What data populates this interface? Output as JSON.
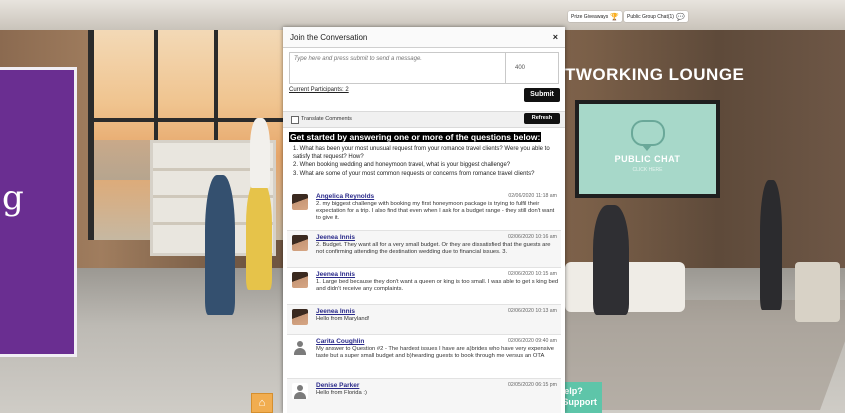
{
  "header_buttons": {
    "prize": "Prize Giveaways",
    "public_chat": "Public Group Chat(1)"
  },
  "lounge": {
    "title": "TWORKING LOUNGE",
    "screen_title": "PUBLIC CHAT",
    "screen_sub": "CLICK HERE"
  },
  "side_panel": {
    "glyph": "g"
  },
  "support": {
    "line1": "Need Help?",
    "line2": "Technical Support"
  },
  "modal": {
    "title": "Join the Conversation",
    "close": "×",
    "placeholder": "Type here and press submit to send a message.",
    "char_count": "400",
    "participants": "Current Participants: 2",
    "submit": "Submit",
    "translate": "Translate Comments",
    "refresh": "Refresh",
    "questions_title": "Get started by answering one or more of the questions below:",
    "questions": [
      "1. What has been your most unusual request from your romance travel clients? Were you able to satisfy that request? How?",
      "2. When booking wedding and honeymoon travel, what is your biggest challenge?",
      "3. What are some of your most common requests or concerns from romance travel clients?"
    ],
    "messages": [
      {
        "name": "Angelica Reynolds",
        "time": "02/06/2020 11:18 am",
        "text": "2.  my biggest challenge with booking my first honeymoon package is trying to fulfil their expectation for a trip.  I also find that even when I ask for a budget range - they still don't want to give it.",
        "avatar": "photo"
      },
      {
        "name": "Jeenea Innis",
        "time": "02/06/2020 10:16 am",
        "text": "2. Budget. They want all for a very small budget. Or they are dissatisfied that the guests are not confirming attending the destination wedding due to financial issues. 3.",
        "avatar": "photo"
      },
      {
        "name": "Jeenea Innis",
        "time": "02/06/2020 10:15 am",
        "text": "1. Large bed because they don't want a queen or king is too small. I was able to get s king bed and didn't receive any complaints.",
        "avatar": "photo"
      },
      {
        "name": "Jeenea Innis",
        "time": "02/06/2020 10:13 am",
        "text": "Hello from Maryland!",
        "avatar": "photo"
      },
      {
        "name": "Carita Coughlin",
        "time": "02/06/2020 09:40 am",
        "text": "My answer to Question #2 - The hardest issues I have are a)brides who have very expensive taste but a super small budget and b)hearding guests to book through me versus an OTA",
        "avatar": "default"
      },
      {
        "name": "Denise Parker",
        "time": "02/05/2020 06:15 pm",
        "text": "Hello from Florida :)",
        "avatar": "default"
      }
    ]
  }
}
